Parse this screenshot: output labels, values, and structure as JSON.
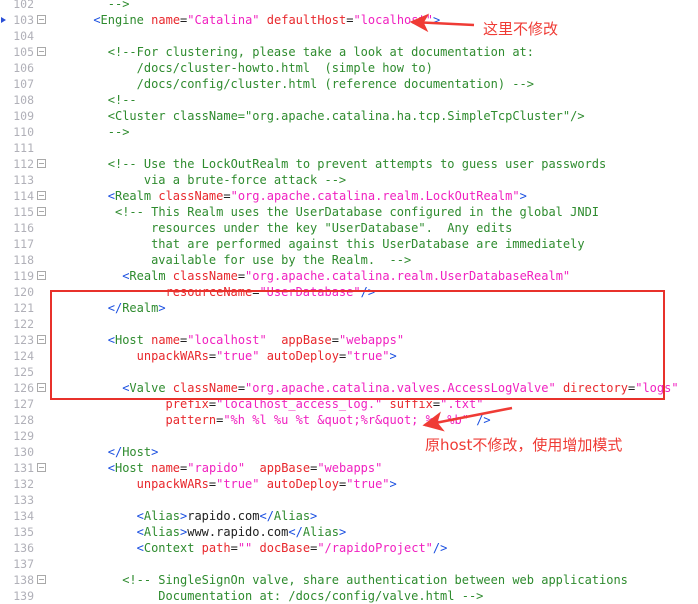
{
  "editor": {
    "kind": "xml-source-editor",
    "file_type": "server.xml (Tomcat)",
    "first_line_number": 102,
    "gutter": {
      "bookmark_lines": [
        103
      ],
      "fold_lines": [
        103,
        105,
        112,
        114,
        115,
        119,
        123,
        126,
        131,
        138
      ]
    },
    "colors": {
      "background": "#ffffff",
      "line_number": "#b0b0b8",
      "bracket": "#1a4fe0",
      "tag_name": "#2e8b2e",
      "attribute_name": "#e8272c",
      "attribute_value": "#f020c0",
      "comment": "#2e8b2e",
      "text": "#202020",
      "annotation_red": "#ef3b35",
      "bookmark_blue": "#2a4fd6"
    },
    "lines": [
      {
        "n": 102,
        "indent": 8,
        "segments": [
          {
            "c": "cmt",
            "t": "-->"
          }
        ]
      },
      {
        "n": 103,
        "indent": 6,
        "segments": [
          {
            "c": "br",
            "t": "<"
          },
          {
            "c": "tag",
            "t": "Engine"
          },
          {
            "c": "txt",
            "t": " "
          },
          {
            "c": "att",
            "t": "name"
          },
          {
            "c": "eq",
            "t": "="
          },
          {
            "c": "val",
            "t": "\"Catalina\""
          },
          {
            "c": "txt",
            "t": " "
          },
          {
            "c": "att",
            "t": "defaultHost"
          },
          {
            "c": "eq",
            "t": "="
          },
          {
            "c": "val",
            "t": "\"localhost\""
          },
          {
            "c": "br",
            "t": ">"
          }
        ]
      },
      {
        "n": 104,
        "indent": 0,
        "segments": []
      },
      {
        "n": 105,
        "indent": 8,
        "segments": [
          {
            "c": "cmt",
            "t": "<!--For clustering, please take a look at documentation at:"
          }
        ]
      },
      {
        "n": 106,
        "indent": 12,
        "segments": [
          {
            "c": "cmt",
            "t": "/docs/cluster-howto.html  (simple how to)"
          }
        ]
      },
      {
        "n": 107,
        "indent": 12,
        "segments": [
          {
            "c": "cmt",
            "t": "/docs/config/cluster.html (reference documentation) -->"
          }
        ]
      },
      {
        "n": 108,
        "indent": 8,
        "segments": [
          {
            "c": "cmt",
            "t": "<!--"
          }
        ]
      },
      {
        "n": 109,
        "indent": 8,
        "segments": [
          {
            "c": "cmt",
            "t": "<Cluster className=\"org.apache.catalina.ha.tcp.SimpleTcpCluster\"/>"
          }
        ]
      },
      {
        "n": 110,
        "indent": 8,
        "segments": [
          {
            "c": "cmt",
            "t": "-->"
          }
        ]
      },
      {
        "n": 111,
        "indent": 0,
        "segments": []
      },
      {
        "n": 112,
        "indent": 8,
        "segments": [
          {
            "c": "cmt",
            "t": "<!-- Use the LockOutRealm to prevent attempts to guess user passwords"
          }
        ]
      },
      {
        "n": 113,
        "indent": 13,
        "segments": [
          {
            "c": "cmt",
            "t": "via a brute-force attack -->"
          }
        ]
      },
      {
        "n": 114,
        "indent": 8,
        "segments": [
          {
            "c": "br",
            "t": "<"
          },
          {
            "c": "tag",
            "t": "Realm"
          },
          {
            "c": "txt",
            "t": " "
          },
          {
            "c": "att",
            "t": "className"
          },
          {
            "c": "eq",
            "t": "="
          },
          {
            "c": "val",
            "t": "\"org.apache.catalina.realm.LockOutRealm\""
          },
          {
            "c": "br",
            "t": ">"
          }
        ]
      },
      {
        "n": 115,
        "indent": 9,
        "segments": [
          {
            "c": "cmt",
            "t": "<!-- This Realm uses the UserDatabase configured in the global JNDI"
          }
        ]
      },
      {
        "n": 116,
        "indent": 14,
        "segments": [
          {
            "c": "cmt",
            "t": "resources under the key \"UserDatabase\".  Any edits"
          }
        ]
      },
      {
        "n": 117,
        "indent": 14,
        "segments": [
          {
            "c": "cmt",
            "t": "that are performed against this UserDatabase are immediately"
          }
        ]
      },
      {
        "n": 118,
        "indent": 14,
        "segments": [
          {
            "c": "cmt",
            "t": "available for use by the Realm.  -->"
          }
        ]
      },
      {
        "n": 119,
        "indent": 10,
        "segments": [
          {
            "c": "br",
            "t": "<"
          },
          {
            "c": "tag",
            "t": "Realm"
          },
          {
            "c": "txt",
            "t": " "
          },
          {
            "c": "att",
            "t": "className"
          },
          {
            "c": "eq",
            "t": "="
          },
          {
            "c": "val",
            "t": "\"org.apache.catalina.realm.UserDatabaseRealm\""
          }
        ]
      },
      {
        "n": 120,
        "indent": 16,
        "segments": [
          {
            "c": "att",
            "t": "resourceName"
          },
          {
            "c": "eq",
            "t": "="
          },
          {
            "c": "val",
            "t": "\"UserDatabase\""
          },
          {
            "c": "br",
            "t": "/>"
          }
        ]
      },
      {
        "n": 121,
        "indent": 8,
        "segments": [
          {
            "c": "br",
            "t": "</"
          },
          {
            "c": "tag",
            "t": "Realm"
          },
          {
            "c": "br",
            "t": ">"
          }
        ]
      },
      {
        "n": 122,
        "indent": 0,
        "segments": []
      },
      {
        "n": 123,
        "indent": 8,
        "segments": [
          {
            "c": "br",
            "t": "<"
          },
          {
            "c": "tag",
            "t": "Host"
          },
          {
            "c": "txt",
            "t": " "
          },
          {
            "c": "att",
            "t": "name"
          },
          {
            "c": "eq",
            "t": "="
          },
          {
            "c": "val",
            "t": "\"localhost\""
          },
          {
            "c": "txt",
            "t": "  "
          },
          {
            "c": "att",
            "t": "appBase"
          },
          {
            "c": "eq",
            "t": "="
          },
          {
            "c": "val",
            "t": "\"webapps\""
          }
        ]
      },
      {
        "n": 124,
        "indent": 12,
        "segments": [
          {
            "c": "att",
            "t": "unpackWARs"
          },
          {
            "c": "eq",
            "t": "="
          },
          {
            "c": "val",
            "t": "\"true\""
          },
          {
            "c": "txt",
            "t": " "
          },
          {
            "c": "att",
            "t": "autoDeploy"
          },
          {
            "c": "eq",
            "t": "="
          },
          {
            "c": "val",
            "t": "\"true\""
          },
          {
            "c": "br",
            "t": ">"
          }
        ]
      },
      {
        "n": 125,
        "indent": 0,
        "segments": []
      },
      {
        "n": 126,
        "indent": 10,
        "segments": [
          {
            "c": "br",
            "t": "<"
          },
          {
            "c": "tag",
            "t": "Valve"
          },
          {
            "c": "txt",
            "t": " "
          },
          {
            "c": "att",
            "t": "className"
          },
          {
            "c": "eq",
            "t": "="
          },
          {
            "c": "val",
            "t": "\"org.apache.catalina.valves.AccessLogValve\""
          },
          {
            "c": "txt",
            "t": " "
          },
          {
            "c": "att",
            "t": "directory"
          },
          {
            "c": "eq",
            "t": "="
          },
          {
            "c": "val",
            "t": "\"logs\""
          }
        ]
      },
      {
        "n": 127,
        "indent": 16,
        "segments": [
          {
            "c": "att",
            "t": "prefix"
          },
          {
            "c": "eq",
            "t": "="
          },
          {
            "c": "val",
            "t": "\"localhost_access_log.\""
          },
          {
            "c": "txt",
            "t": " "
          },
          {
            "c": "att",
            "t": "suffix"
          },
          {
            "c": "eq",
            "t": "="
          },
          {
            "c": "val",
            "t": "\".txt\""
          }
        ]
      },
      {
        "n": 128,
        "indent": 16,
        "segments": [
          {
            "c": "att",
            "t": "pattern"
          },
          {
            "c": "eq",
            "t": "="
          },
          {
            "c": "val",
            "t": "\"%h %l %u %t &quot;%r&quot; %s %b\""
          },
          {
            "c": "txt",
            "t": " "
          },
          {
            "c": "br",
            "t": "/>"
          }
        ]
      },
      {
        "n": 129,
        "indent": 0,
        "segments": []
      },
      {
        "n": 130,
        "indent": 8,
        "segments": [
          {
            "c": "br",
            "t": "</"
          },
          {
            "c": "tag",
            "t": "Host"
          },
          {
            "c": "br",
            "t": ">"
          }
        ]
      },
      {
        "n": 131,
        "indent": 8,
        "segments": [
          {
            "c": "br",
            "t": "<"
          },
          {
            "c": "tag",
            "t": "Host"
          },
          {
            "c": "txt",
            "t": " "
          },
          {
            "c": "att",
            "t": "name"
          },
          {
            "c": "eq",
            "t": "="
          },
          {
            "c": "val",
            "t": "\"rapido\""
          },
          {
            "c": "txt",
            "t": "  "
          },
          {
            "c": "att",
            "t": "appBase"
          },
          {
            "c": "eq",
            "t": "="
          },
          {
            "c": "val",
            "t": "\"webapps\""
          }
        ]
      },
      {
        "n": 132,
        "indent": 12,
        "segments": [
          {
            "c": "att",
            "t": "unpackWARs"
          },
          {
            "c": "eq",
            "t": "="
          },
          {
            "c": "val",
            "t": "\"true\""
          },
          {
            "c": "txt",
            "t": " "
          },
          {
            "c": "att",
            "t": "autoDeploy"
          },
          {
            "c": "eq",
            "t": "="
          },
          {
            "c": "val",
            "t": "\"true\""
          },
          {
            "c": "br",
            "t": ">"
          }
        ]
      },
      {
        "n": 133,
        "indent": 0,
        "segments": []
      },
      {
        "n": 134,
        "indent": 12,
        "segments": [
          {
            "c": "br",
            "t": "<"
          },
          {
            "c": "tag",
            "t": "Alias"
          },
          {
            "c": "br",
            "t": ">"
          },
          {
            "c": "txt",
            "t": "rapido.com"
          },
          {
            "c": "br",
            "t": "</"
          },
          {
            "c": "tag",
            "t": "Alias"
          },
          {
            "c": "br",
            "t": ">"
          }
        ]
      },
      {
        "n": 135,
        "indent": 12,
        "segments": [
          {
            "c": "br",
            "t": "<"
          },
          {
            "c": "tag",
            "t": "Alias"
          },
          {
            "c": "br",
            "t": ">"
          },
          {
            "c": "txt",
            "t": "www.rapido.com"
          },
          {
            "c": "br",
            "t": "</"
          },
          {
            "c": "tag",
            "t": "Alias"
          },
          {
            "c": "br",
            "t": ">"
          }
        ]
      },
      {
        "n": 136,
        "indent": 12,
        "segments": [
          {
            "c": "br",
            "t": "<"
          },
          {
            "c": "tag",
            "t": "Context"
          },
          {
            "c": "txt",
            "t": " "
          },
          {
            "c": "att",
            "t": "path"
          },
          {
            "c": "eq",
            "t": "="
          },
          {
            "c": "val",
            "t": "\"\""
          },
          {
            "c": "txt",
            "t": " "
          },
          {
            "c": "att",
            "t": "docBase"
          },
          {
            "c": "eq",
            "t": "="
          },
          {
            "c": "val",
            "t": "\"/rapidoProject\""
          },
          {
            "c": "br",
            "t": "/>"
          }
        ]
      },
      {
        "n": 137,
        "indent": 0,
        "segments": []
      },
      {
        "n": 138,
        "indent": 10,
        "segments": [
          {
            "c": "cmt",
            "t": "<!-- SingleSignOn valve, share authentication between web applications"
          }
        ]
      },
      {
        "n": 139,
        "indent": 15,
        "segments": [
          {
            "c": "cmt",
            "t": "Documentation at: /docs/config/valve.html -->"
          }
        ]
      }
    ]
  },
  "annotations": {
    "top_note": {
      "text": "这里不修改",
      "meaning": "do-not-modify-here",
      "color": "#ef3b35"
    },
    "bottom_note": {
      "text": "原host不修改，使用增加模式",
      "meaning": "keep-original-host-use-append-mode",
      "color": "#ef3b35"
    },
    "highlight_box": {
      "label": "original-localhost-host-block",
      "covers_lines": "123-130",
      "color": "#e8312b"
    },
    "arrows": [
      {
        "label": "arrow-to-engine-tag",
        "target_line": 103
      },
      {
        "label": "arrow-to-rapido-host-tag",
        "target_line": 132
      }
    ]
  }
}
